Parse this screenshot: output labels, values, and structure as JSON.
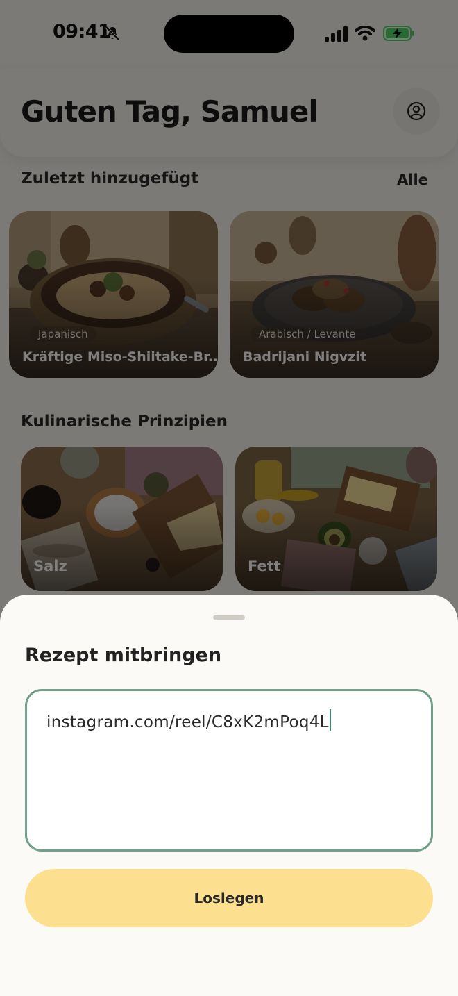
{
  "status_bar": {
    "time": "09:41"
  },
  "header": {
    "greeting": "Guten Tag, Samuel"
  },
  "recent": {
    "title": "Zuletzt hinzugefügt",
    "see_all": "Alle",
    "cards": [
      {
        "tag": "Japanisch",
        "title": "Kräftige Miso-Shiitake-Br..."
      },
      {
        "tag": "Arabisch / Levante",
        "title": "Badrijani Nigvzit"
      }
    ]
  },
  "principles": {
    "title": "Kulinarische Prinzipien",
    "cards": [
      {
        "label": "Salz"
      },
      {
        "label": "Fett"
      }
    ]
  },
  "sheet": {
    "title": "Rezept mitbringen",
    "input_value": "instagram.com/reel/C8xK2mPoq4L",
    "button_label": "Loslegen"
  },
  "colors": {
    "accent_border": "#6fa18b",
    "cta_background": "#fde08f",
    "battery_green": "#4cd964"
  }
}
